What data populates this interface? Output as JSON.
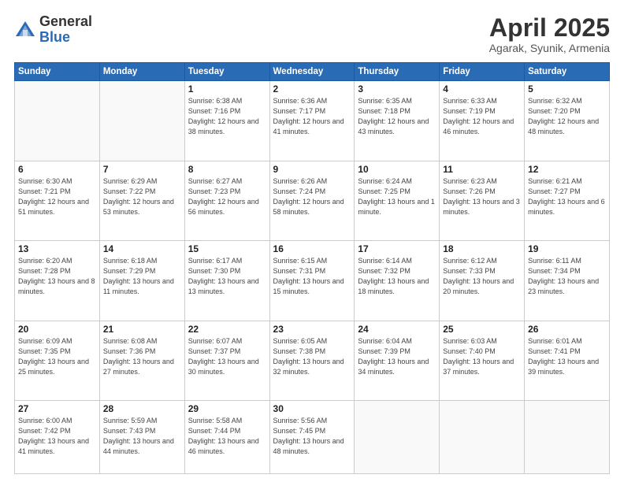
{
  "header": {
    "logo_general": "General",
    "logo_blue": "Blue",
    "month_title": "April 2025",
    "subtitle": "Agarak, Syunik, Armenia"
  },
  "weekdays": [
    "Sunday",
    "Monday",
    "Tuesday",
    "Wednesday",
    "Thursday",
    "Friday",
    "Saturday"
  ],
  "weeks": [
    [
      {
        "day": "",
        "sunrise": "",
        "sunset": "",
        "daylight": ""
      },
      {
        "day": "",
        "sunrise": "",
        "sunset": "",
        "daylight": ""
      },
      {
        "day": "1",
        "sunrise": "Sunrise: 6:38 AM",
        "sunset": "Sunset: 7:16 PM",
        "daylight": "Daylight: 12 hours and 38 minutes."
      },
      {
        "day": "2",
        "sunrise": "Sunrise: 6:36 AM",
        "sunset": "Sunset: 7:17 PM",
        "daylight": "Daylight: 12 hours and 41 minutes."
      },
      {
        "day": "3",
        "sunrise": "Sunrise: 6:35 AM",
        "sunset": "Sunset: 7:18 PM",
        "daylight": "Daylight: 12 hours and 43 minutes."
      },
      {
        "day": "4",
        "sunrise": "Sunrise: 6:33 AM",
        "sunset": "Sunset: 7:19 PM",
        "daylight": "Daylight: 12 hours and 46 minutes."
      },
      {
        "day": "5",
        "sunrise": "Sunrise: 6:32 AM",
        "sunset": "Sunset: 7:20 PM",
        "daylight": "Daylight: 12 hours and 48 minutes."
      }
    ],
    [
      {
        "day": "6",
        "sunrise": "Sunrise: 6:30 AM",
        "sunset": "Sunset: 7:21 PM",
        "daylight": "Daylight: 12 hours and 51 minutes."
      },
      {
        "day": "7",
        "sunrise": "Sunrise: 6:29 AM",
        "sunset": "Sunset: 7:22 PM",
        "daylight": "Daylight: 12 hours and 53 minutes."
      },
      {
        "day": "8",
        "sunrise": "Sunrise: 6:27 AM",
        "sunset": "Sunset: 7:23 PM",
        "daylight": "Daylight: 12 hours and 56 minutes."
      },
      {
        "day": "9",
        "sunrise": "Sunrise: 6:26 AM",
        "sunset": "Sunset: 7:24 PM",
        "daylight": "Daylight: 12 hours and 58 minutes."
      },
      {
        "day": "10",
        "sunrise": "Sunrise: 6:24 AM",
        "sunset": "Sunset: 7:25 PM",
        "daylight": "Daylight: 13 hours and 1 minute."
      },
      {
        "day": "11",
        "sunrise": "Sunrise: 6:23 AM",
        "sunset": "Sunset: 7:26 PM",
        "daylight": "Daylight: 13 hours and 3 minutes."
      },
      {
        "day": "12",
        "sunrise": "Sunrise: 6:21 AM",
        "sunset": "Sunset: 7:27 PM",
        "daylight": "Daylight: 13 hours and 6 minutes."
      }
    ],
    [
      {
        "day": "13",
        "sunrise": "Sunrise: 6:20 AM",
        "sunset": "Sunset: 7:28 PM",
        "daylight": "Daylight: 13 hours and 8 minutes."
      },
      {
        "day": "14",
        "sunrise": "Sunrise: 6:18 AM",
        "sunset": "Sunset: 7:29 PM",
        "daylight": "Daylight: 13 hours and 11 minutes."
      },
      {
        "day": "15",
        "sunrise": "Sunrise: 6:17 AM",
        "sunset": "Sunset: 7:30 PM",
        "daylight": "Daylight: 13 hours and 13 minutes."
      },
      {
        "day": "16",
        "sunrise": "Sunrise: 6:15 AM",
        "sunset": "Sunset: 7:31 PM",
        "daylight": "Daylight: 13 hours and 15 minutes."
      },
      {
        "day": "17",
        "sunrise": "Sunrise: 6:14 AM",
        "sunset": "Sunset: 7:32 PM",
        "daylight": "Daylight: 13 hours and 18 minutes."
      },
      {
        "day": "18",
        "sunrise": "Sunrise: 6:12 AM",
        "sunset": "Sunset: 7:33 PM",
        "daylight": "Daylight: 13 hours and 20 minutes."
      },
      {
        "day": "19",
        "sunrise": "Sunrise: 6:11 AM",
        "sunset": "Sunset: 7:34 PM",
        "daylight": "Daylight: 13 hours and 23 minutes."
      }
    ],
    [
      {
        "day": "20",
        "sunrise": "Sunrise: 6:09 AM",
        "sunset": "Sunset: 7:35 PM",
        "daylight": "Daylight: 13 hours and 25 minutes."
      },
      {
        "day": "21",
        "sunrise": "Sunrise: 6:08 AM",
        "sunset": "Sunset: 7:36 PM",
        "daylight": "Daylight: 13 hours and 27 minutes."
      },
      {
        "day": "22",
        "sunrise": "Sunrise: 6:07 AM",
        "sunset": "Sunset: 7:37 PM",
        "daylight": "Daylight: 13 hours and 30 minutes."
      },
      {
        "day": "23",
        "sunrise": "Sunrise: 6:05 AM",
        "sunset": "Sunset: 7:38 PM",
        "daylight": "Daylight: 13 hours and 32 minutes."
      },
      {
        "day": "24",
        "sunrise": "Sunrise: 6:04 AM",
        "sunset": "Sunset: 7:39 PM",
        "daylight": "Daylight: 13 hours and 34 minutes."
      },
      {
        "day": "25",
        "sunrise": "Sunrise: 6:03 AM",
        "sunset": "Sunset: 7:40 PM",
        "daylight": "Daylight: 13 hours and 37 minutes."
      },
      {
        "day": "26",
        "sunrise": "Sunrise: 6:01 AM",
        "sunset": "Sunset: 7:41 PM",
        "daylight": "Daylight: 13 hours and 39 minutes."
      }
    ],
    [
      {
        "day": "27",
        "sunrise": "Sunrise: 6:00 AM",
        "sunset": "Sunset: 7:42 PM",
        "daylight": "Daylight: 13 hours and 41 minutes."
      },
      {
        "day": "28",
        "sunrise": "Sunrise: 5:59 AM",
        "sunset": "Sunset: 7:43 PM",
        "daylight": "Daylight: 13 hours and 44 minutes."
      },
      {
        "day": "29",
        "sunrise": "Sunrise: 5:58 AM",
        "sunset": "Sunset: 7:44 PM",
        "daylight": "Daylight: 13 hours and 46 minutes."
      },
      {
        "day": "30",
        "sunrise": "Sunrise: 5:56 AM",
        "sunset": "Sunset: 7:45 PM",
        "daylight": "Daylight: 13 hours and 48 minutes."
      },
      {
        "day": "",
        "sunrise": "",
        "sunset": "",
        "daylight": ""
      },
      {
        "day": "",
        "sunrise": "",
        "sunset": "",
        "daylight": ""
      },
      {
        "day": "",
        "sunrise": "",
        "sunset": "",
        "daylight": ""
      }
    ]
  ]
}
